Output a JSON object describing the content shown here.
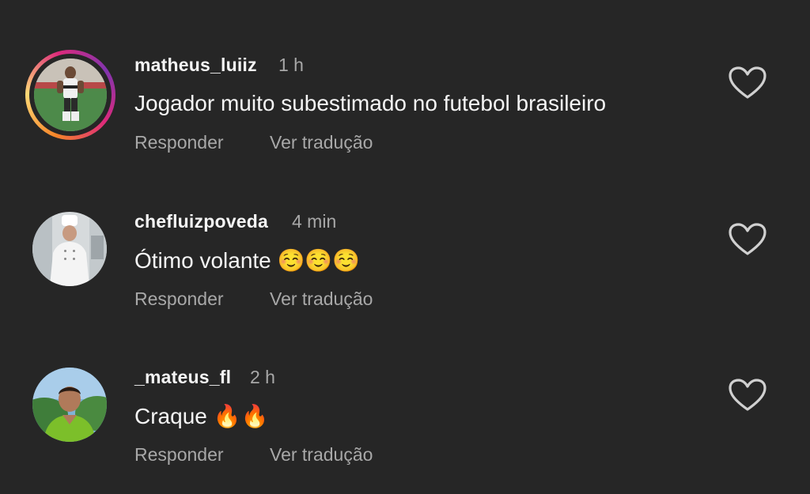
{
  "comments": [
    {
      "username": "matheus_luiiz",
      "time": "1 h",
      "text": "Jogador muito subestimado no futebol brasileiro",
      "reply_label": "Responder",
      "translate_label": "Ver tradução",
      "has_story_ring": true,
      "like_icon": "heart-outline-icon"
    },
    {
      "username": "chefluizpoveda",
      "time": "4 min",
      "text": "Ótimo volante ☺️☺️☺️",
      "reply_label": "Responder",
      "translate_label": "Ver tradução",
      "has_story_ring": false,
      "like_icon": "heart-outline-icon"
    },
    {
      "username": "_mateus_fl",
      "time": "2 h",
      "text": "Craque 🔥🔥",
      "reply_label": "Responder",
      "translate_label": "Ver tradução",
      "has_story_ring": false,
      "like_icon": "heart-outline-icon"
    }
  ],
  "colors": {
    "background": "#262626",
    "primary_text": "#f5f5f5",
    "secondary_text": "#a8a8a8",
    "story_ring": [
      "#f58529",
      "#dd2a7b",
      "#8134af"
    ]
  }
}
